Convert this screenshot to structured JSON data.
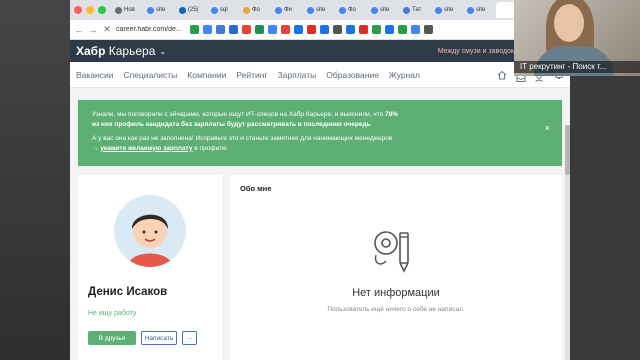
{
  "browser": {
    "tabs": [
      {
        "label": "Нов",
        "color": "#6d6d6d"
      },
      {
        "label": "site",
        "color": "#4285f4"
      },
      {
        "label": "(25(",
        "color": "#0a66c2"
      },
      {
        "label": "sql",
        "color": "#4285f4"
      },
      {
        "label": "Фо",
        "color": "#e8a33d"
      },
      {
        "label": "Фи",
        "color": "#4285f4"
      },
      {
        "label": "site",
        "color": "#4285f4"
      },
      {
        "label": "Фо",
        "color": "#4285f4"
      },
      {
        "label": "site",
        "color": "#4285f4"
      },
      {
        "label": "Тат",
        "color": "#3e7bd6"
      },
      {
        "label": "site",
        "color": "#4285f4"
      },
      {
        "label": "site",
        "color": "#4285f4"
      },
      {
        "label": "",
        "color": "#ffffff"
      }
    ],
    "url": "career.habr.com/de...",
    "bookmark_colors": [
      "#2d9c4a",
      "#4285f4",
      "#3e7bd6",
      "#2a6bd1",
      "#e0463a",
      "#1f8f54",
      "#4285f4",
      "#e0463a",
      "#1a73e8",
      "#d93025",
      "#1a73e8",
      "#555555",
      "#1a73e8",
      "#d93025",
      "#2d9c4a",
      "#1a73e8",
      "#2d9c4a",
      "#4285f4",
      "#555555"
    ]
  },
  "header": {
    "logo_bold": "Хабр",
    "logo_light": "Карьера",
    "promo": "Между смузи и заводом: хотим знать в"
  },
  "nav": {
    "items": [
      "Вакансии",
      "Специалисты",
      "Компании",
      "Рейтинг",
      "Зарплаты",
      "Образование",
      "Журнал"
    ],
    "icons": [
      "home-icon",
      "inbox-icon",
      "friends-icon",
      "bell-icon"
    ]
  },
  "notice": {
    "line1a": "Узнали, мы поговорили с эйчарами, которые ищут ИТ-спецов на Хабр Карьере, и выяснили, что ",
    "line1b": "78%",
    "line1c": "из них профиль кандидата без зарплаты будут рассматривать в последнюю очередь",
    "line2": "А у вас она как раз не заполнена! Исправьте это и станьте заметнее для нанимающих менеджеров",
    "link_prefix": "→ ",
    "link": "укажите желаемую зарплату",
    "link_suffix": " в профиле",
    "close": "×",
    "bg_color": "#5daf73"
  },
  "profile": {
    "name": "Денис Исаков",
    "status": "Не ищу работу",
    "add_friend": "В друзья",
    "write": "Написать",
    "more": "···"
  },
  "about": {
    "title": "Обо мне",
    "empty_title": "Нет информации",
    "empty_subtitle": "Пользователь ещё ничего о себе не написал."
  },
  "webcam": {
    "caption": "IT рекрутинг - Поиск т..."
  }
}
